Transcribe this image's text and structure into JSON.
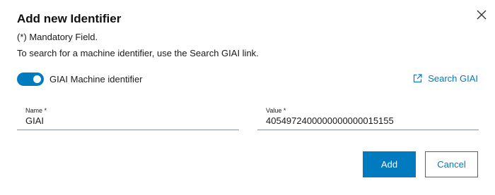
{
  "dialog": {
    "title": "Add new Identifier",
    "mandatory_note": "(*) Mandatory Field.",
    "hint": "To search for a machine identifier, use the Search GIAI link.",
    "close_icon": "close-icon"
  },
  "toggle": {
    "label": "GIAI Machine identifier",
    "checked": true
  },
  "search_link": {
    "label": "Search GIAI",
    "icon": "external-link-icon"
  },
  "fields": {
    "name": {
      "label": "Name *",
      "value": "GIAI"
    },
    "value": {
      "label": "Value *",
      "value": "4054972400000000000015155"
    }
  },
  "buttons": {
    "add": "Add",
    "cancel": "Cancel"
  },
  "colors": {
    "accent": "#007bc0",
    "underline": "#8a9097"
  }
}
